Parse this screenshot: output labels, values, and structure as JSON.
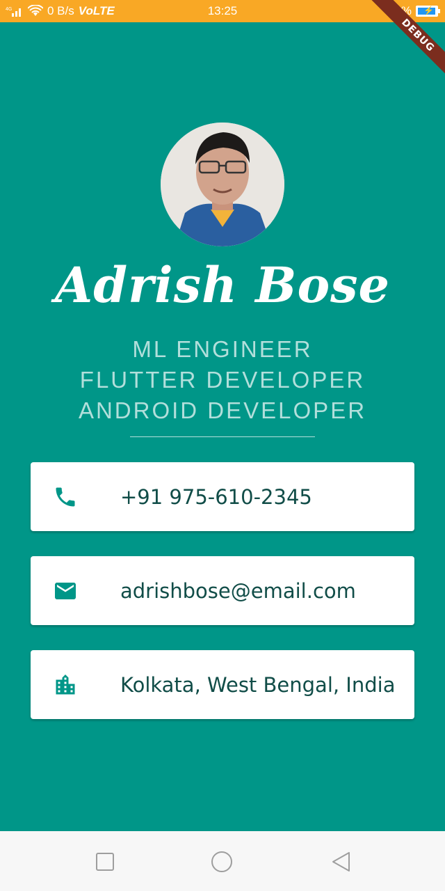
{
  "status_bar": {
    "network": "0 B/s",
    "volte": "VoLTE",
    "time": "13:25",
    "battery": "91%",
    "color": "#F9A825"
  },
  "debug_banner": "DEBUG",
  "profile": {
    "name": "Adrish Bose",
    "roles": [
      "ML ENGINEER",
      "FLUTTER DEVELOPER",
      "ANDROID DEVELOPER"
    ]
  },
  "contacts": [
    {
      "icon": "phone-icon",
      "text": "+91 975-610-2345"
    },
    {
      "icon": "email-icon",
      "text": "adrishbose@email.com"
    },
    {
      "icon": "location-city-icon",
      "text": "Kolkata, West Bengal, India"
    }
  ],
  "navigation": [
    "recent-apps-icon",
    "home-icon",
    "back-icon"
  ],
  "colors": {
    "background": "#009688",
    "role_text": "#B2DFDB",
    "card_text": "#114d48",
    "accent": "#009688"
  }
}
